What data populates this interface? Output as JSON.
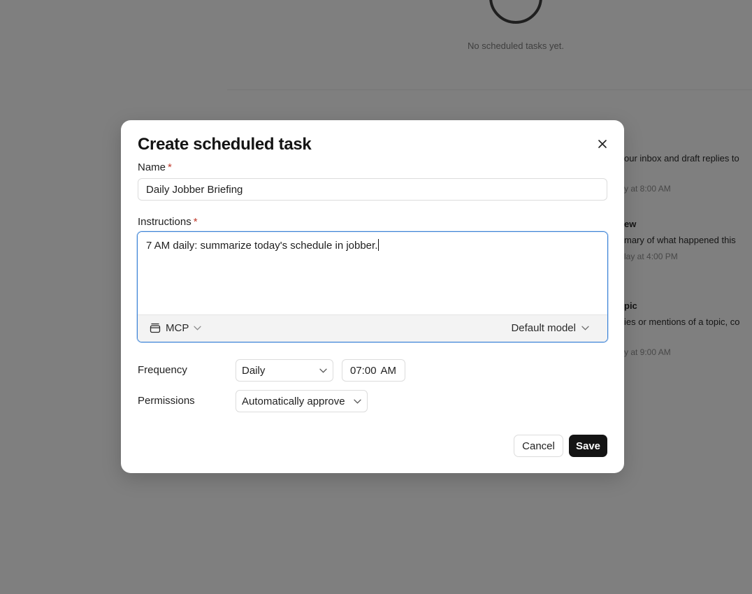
{
  "background": {
    "empty_state": "No scheduled tasks yet.",
    "snippets": {
      "s1": "our inbox and draft replies to",
      "s1_time": "y at 8:00 AM",
      "s2_title": "ew",
      "s2": "mary of what happened this",
      "s2_time": "lay at 4:00 PM",
      "s3_title": "pic",
      "s3": "ies or mentions of a topic, co",
      "s3_time": "y at 9:00 AM"
    }
  },
  "dialog": {
    "title": "Create scheduled task",
    "name_label": "Name",
    "required_mark": "*",
    "name_value": "Daily Jobber Briefing",
    "instructions_label": "Instructions",
    "instructions_value": "7 AM daily: summarize today's schedule in jobber.",
    "mcp_label": "MCP",
    "model_label": "Default model",
    "frequency_label": "Frequency",
    "frequency_value": "Daily",
    "time_value": "07:00",
    "time_period": "AM",
    "permissions_label": "Permissions",
    "permissions_value": "Automatically approve",
    "cancel_label": "Cancel",
    "save_label": "Save"
  },
  "icons": {
    "close": "close-icon",
    "mcp": "folder-icon",
    "chevron": "chevron-down-icon"
  },
  "colors": {
    "required": "#c0392b",
    "focus_border": "#3b82d6",
    "primary_button": "#141414"
  }
}
